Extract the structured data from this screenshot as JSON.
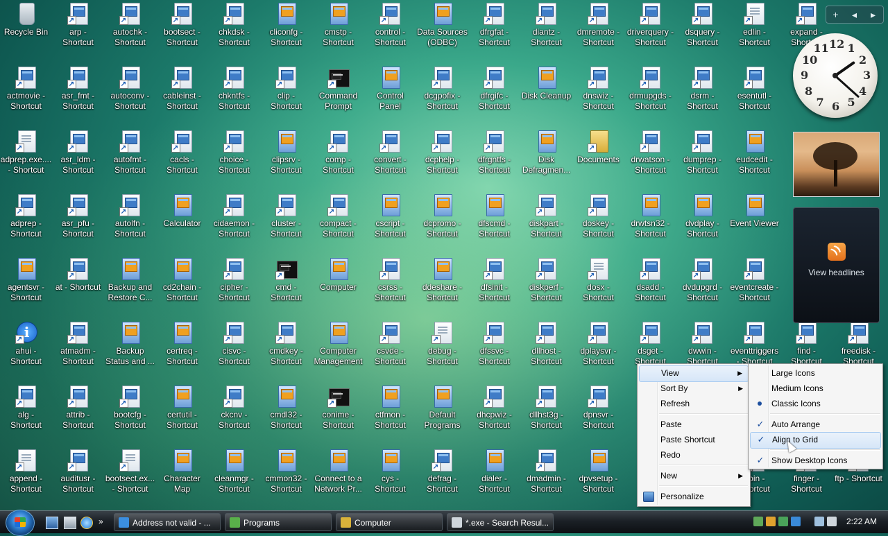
{
  "desktop": {
    "columns": [
      [
        {
          "label": "Recycle Bin",
          "icon": "recycle-bin-icon",
          "kind": "bin"
        },
        {
          "label": "actmovie -\nShortcut",
          "icon": "shortcut-icon",
          "kind": "sc"
        },
        {
          "label": "adprep.exe....\n- Shortcut",
          "icon": "shortcut-icon",
          "kind": "doc"
        },
        {
          "label": "adprep -\nShortcut",
          "icon": "shortcut-icon",
          "kind": "sc"
        },
        {
          "label": "agentsvr -\nShortcut",
          "icon": "shortcut-icon",
          "kind": "app"
        },
        {
          "label": "ahui -\nShortcut",
          "icon": "info-icon",
          "kind": "info"
        },
        {
          "label": "alg -\nShortcut",
          "icon": "shortcut-icon",
          "kind": "sc"
        },
        {
          "label": "append -\nShortcut",
          "icon": "shortcut-icon",
          "kind": "doc"
        }
      ],
      [
        {
          "label": "arp -\nShortcut",
          "icon": "shortcut-icon",
          "kind": "sc"
        },
        {
          "label": "asr_fmt -\nShortcut",
          "icon": "shortcut-icon",
          "kind": "sc"
        },
        {
          "label": "asr_ldm -\nShortcut",
          "icon": "shortcut-icon",
          "kind": "sc"
        },
        {
          "label": "asr_pfu -\nShortcut",
          "icon": "shortcut-icon",
          "kind": "sc"
        },
        {
          "label": "at - Shortcut",
          "icon": "shortcut-icon",
          "kind": "sc"
        },
        {
          "label": "atmadm -\nShortcut",
          "icon": "shortcut-icon",
          "kind": "sc"
        },
        {
          "label": "attrib -\nShortcut",
          "icon": "shortcut-icon",
          "kind": "sc"
        },
        {
          "label": "auditusr -\nShortcut",
          "icon": "shortcut-icon",
          "kind": "sc"
        }
      ],
      [
        {
          "label": "autochk -\nShortcut",
          "icon": "shortcut-icon",
          "kind": "sc"
        },
        {
          "label": "autoconv -\nShortcut",
          "icon": "shortcut-icon",
          "kind": "sc"
        },
        {
          "label": "autofmt -\nShortcut",
          "icon": "shortcut-icon",
          "kind": "sc"
        },
        {
          "label": "autolfn -\nShortcut",
          "icon": "shortcut-icon",
          "kind": "sc"
        },
        {
          "label": "Backup and\nRestore C...",
          "icon": "backup-icon",
          "kind": "app"
        },
        {
          "label": "Backup\nStatus and ...",
          "icon": "backup-icon",
          "kind": "app"
        },
        {
          "label": "bootcfg -\nShortcut",
          "icon": "shortcut-icon",
          "kind": "sc"
        },
        {
          "label": "bootsect.ex...\n- Shortcut",
          "icon": "shortcut-icon",
          "kind": "doc"
        }
      ],
      [
        {
          "label": "bootsect -\nShortcut",
          "icon": "shortcut-icon",
          "kind": "sc"
        },
        {
          "label": "cableinst -\nShortcut",
          "icon": "shortcut-icon",
          "kind": "sc"
        },
        {
          "label": "cacls -\nShortcut",
          "icon": "shortcut-icon",
          "kind": "sc"
        },
        {
          "label": "Calculator",
          "icon": "calculator-icon",
          "kind": "app"
        },
        {
          "label": "cd2chain -\nShortcut",
          "icon": "shortcut-icon",
          "kind": "app"
        },
        {
          "label": "certreq -\nShortcut",
          "icon": "shortcut-icon",
          "kind": "app"
        },
        {
          "label": "certutil -\nShortcut",
          "icon": "shortcut-icon",
          "kind": "app"
        },
        {
          "label": "Character\nMap",
          "icon": "character-map-icon",
          "kind": "app"
        }
      ],
      [
        {
          "label": "chkdsk -\nShortcut",
          "icon": "shortcut-icon",
          "kind": "sc"
        },
        {
          "label": "chkntfs -\nShortcut",
          "icon": "shortcut-icon",
          "kind": "sc"
        },
        {
          "label": "choice -\nShortcut",
          "icon": "shortcut-icon",
          "kind": "sc"
        },
        {
          "label": "cidaemon -\nShortcut",
          "icon": "shortcut-icon",
          "kind": "sc"
        },
        {
          "label": "cipher -\nShortcut",
          "icon": "shortcut-icon",
          "kind": "sc"
        },
        {
          "label": "cisvc -\nShortcut",
          "icon": "shortcut-icon",
          "kind": "sc"
        },
        {
          "label": "ckcnv -\nShortcut",
          "icon": "shortcut-icon",
          "kind": "sc"
        },
        {
          "label": "cleanmgr -\nShortcut",
          "icon": "shortcut-icon",
          "kind": "app"
        }
      ],
      [
        {
          "label": "cliconfg -\nShortcut",
          "icon": "shortcut-icon",
          "kind": "app"
        },
        {
          "label": "clip -\nShortcut",
          "icon": "shortcut-icon",
          "kind": "sc"
        },
        {
          "label": "clipsrv -\nShortcut",
          "icon": "shortcut-icon",
          "kind": "app"
        },
        {
          "label": "cluster -\nShortcut",
          "icon": "shortcut-icon",
          "kind": "sc"
        },
        {
          "label": "cmd -\nShortcut",
          "icon": "cmd-icon",
          "kind": "cmd"
        },
        {
          "label": "cmdkey -\nShortcut",
          "icon": "shortcut-icon",
          "kind": "sc"
        },
        {
          "label": "cmdl32 -\nShortcut",
          "icon": "shortcut-icon",
          "kind": "app"
        },
        {
          "label": "cmmon32 -\nShortcut",
          "icon": "shortcut-icon",
          "kind": "app"
        }
      ],
      [
        {
          "label": "cmstp -\nShortcut",
          "icon": "shortcut-icon",
          "kind": "app"
        },
        {
          "label": "Command\nPrompt",
          "icon": "cmd-icon",
          "kind": "cmd"
        },
        {
          "label": "comp -\nShortcut",
          "icon": "shortcut-icon",
          "kind": "sc"
        },
        {
          "label": "compact -\nShortcut",
          "icon": "shortcut-icon",
          "kind": "sc"
        },
        {
          "label": "Computer",
          "icon": "computer-icon",
          "kind": "app"
        },
        {
          "label": "Computer\nManagement",
          "icon": "computer-icon",
          "kind": "app"
        },
        {
          "label": "conime -\nShortcut",
          "icon": "cmd-icon",
          "kind": "cmd"
        },
        {
          "label": "Connect to a\nNetwork Pr...",
          "icon": "network-icon",
          "kind": "app"
        }
      ],
      [
        {
          "label": "control -\nShortcut",
          "icon": "shortcut-icon",
          "kind": "sc"
        },
        {
          "label": "Control\nPanel",
          "icon": "control-panel-icon",
          "kind": "app"
        },
        {
          "label": "convert -\nShortcut",
          "icon": "shortcut-icon",
          "kind": "sc"
        },
        {
          "label": "cscript -\nShortcut",
          "icon": "shortcut-icon",
          "kind": "app"
        },
        {
          "label": "csrss -\nShortcut",
          "icon": "shortcut-icon",
          "kind": "sc"
        },
        {
          "label": "csvde -\nShortcut",
          "icon": "shortcut-icon",
          "kind": "sc"
        },
        {
          "label": "ctfmon -\nShortcut",
          "icon": "shortcut-icon",
          "kind": "app"
        },
        {
          "label": "cys -\nShortcut",
          "icon": "shortcut-icon",
          "kind": "app"
        }
      ],
      [
        {
          "label": "Data Sources\n(ODBC)",
          "icon": "odbc-icon",
          "kind": "app"
        },
        {
          "label": "dcgpofix -\nShortcut",
          "icon": "shortcut-icon",
          "kind": "sc"
        },
        {
          "label": "dcphelp -\nShortcut",
          "icon": "shortcut-icon",
          "kind": "sc"
        },
        {
          "label": "dcpromo -\nShortcut",
          "icon": "shortcut-icon",
          "kind": "app"
        },
        {
          "label": "ddeshare -\nShortcut",
          "icon": "shortcut-icon",
          "kind": "app"
        },
        {
          "label": "debug -\nShortcut",
          "icon": "shortcut-icon",
          "kind": "doc"
        },
        {
          "label": "Default\nPrograms",
          "icon": "default-programs-icon",
          "kind": "app"
        },
        {
          "label": "defrag -\nShortcut",
          "icon": "shortcut-icon",
          "kind": "sc"
        }
      ],
      [
        {
          "label": "dfrgfat -\nShortcut",
          "icon": "shortcut-icon",
          "kind": "sc"
        },
        {
          "label": "dfrgifc -\nShortcut",
          "icon": "shortcut-icon",
          "kind": "sc"
        },
        {
          "label": "dfrgntfs -\nShortcut",
          "icon": "shortcut-icon",
          "kind": "sc"
        },
        {
          "label": "dfscmd -\nShortcut",
          "icon": "shortcut-icon",
          "kind": "app"
        },
        {
          "label": "dfsinit -\nShortcut",
          "icon": "shortcut-icon",
          "kind": "sc"
        },
        {
          "label": "dfssvc -\nShortcut",
          "icon": "shortcut-icon",
          "kind": "sc"
        },
        {
          "label": "dhcpwiz -\nShortcut",
          "icon": "shortcut-icon",
          "kind": "sc"
        },
        {
          "label": "dialer -\nShortcut",
          "icon": "shortcut-icon",
          "kind": "app"
        }
      ],
      [
        {
          "label": "diantz -\nShortcut",
          "icon": "shortcut-icon",
          "kind": "sc"
        },
        {
          "label": "Disk Cleanup",
          "icon": "disk-cleanup-icon",
          "kind": "app"
        },
        {
          "label": "Disk\nDefragmen...",
          "icon": "defrag-icon",
          "kind": "app"
        },
        {
          "label": "diskpart -\nShortcut",
          "icon": "shortcut-icon",
          "kind": "sc"
        },
        {
          "label": "diskperf -\nShortcut",
          "icon": "shortcut-icon",
          "kind": "sc"
        },
        {
          "label": "dllhost -\nShortcut",
          "icon": "shortcut-icon",
          "kind": "sc"
        },
        {
          "label": "dllhst3g -\nShortcut",
          "icon": "shortcut-icon",
          "kind": "sc"
        },
        {
          "label": "dmadmin -\nShortcut",
          "icon": "shortcut-icon",
          "kind": "sc"
        }
      ],
      [
        {
          "label": "dmremote -\nShortcut",
          "icon": "shortcut-icon",
          "kind": "sc"
        },
        {
          "label": "dnswiz -\nShortcut",
          "icon": "shortcut-icon",
          "kind": "sc"
        },
        {
          "label": "Documents",
          "icon": "documents-icon",
          "kind": "folder"
        },
        {
          "label": "doskey -\nShortcut",
          "icon": "shortcut-icon",
          "kind": "sc"
        },
        {
          "label": "dosx -\nShortcut",
          "icon": "shortcut-icon",
          "kind": "doc"
        },
        {
          "label": "dplaysvr -\nShortcut",
          "icon": "shortcut-icon",
          "kind": "sc"
        },
        {
          "label": "dpnsvr -\nShortcut",
          "icon": "shortcut-icon",
          "kind": "sc"
        },
        {
          "label": "dpvsetup -\nShortcut",
          "icon": "shortcut-icon",
          "kind": "app"
        }
      ],
      [
        {
          "label": "driverquery -\nShortcut",
          "icon": "shortcut-icon",
          "kind": "sc"
        },
        {
          "label": "drmupgds -\nShortcut",
          "icon": "shortcut-icon",
          "kind": "sc"
        },
        {
          "label": "drwatson -\nShortcut",
          "icon": "shortcut-icon",
          "kind": "sc"
        },
        {
          "label": "drwtsn32 -\nShortcut",
          "icon": "shortcut-icon",
          "kind": "app"
        },
        {
          "label": "dsadd -\nShortcut",
          "icon": "shortcut-icon",
          "kind": "sc"
        },
        {
          "label": "dsget -\nShortcut",
          "icon": "shortcut-icon",
          "kind": "sc"
        }
      ],
      [
        {
          "label": "dsquery -\nShortcut",
          "icon": "shortcut-icon",
          "kind": "sc"
        },
        {
          "label": "dsrm -\nShortcut",
          "icon": "shortcut-icon",
          "kind": "sc"
        },
        {
          "label": "dumprep -\nShortcut",
          "icon": "shortcut-icon",
          "kind": "sc"
        },
        {
          "label": "dvdplay -\nShortcut",
          "icon": "dvd-icon",
          "kind": "app"
        },
        {
          "label": "dvdupgrd -\nShortcut",
          "icon": "shortcut-icon",
          "kind": "sc"
        },
        {
          "label": "dwwin -\nShortcut",
          "icon": "shortcut-icon",
          "kind": "sc"
        }
      ],
      [
        {
          "label": "edlin -\nShortcut",
          "icon": "shortcut-icon",
          "kind": "doc"
        },
        {
          "label": "esentutl -\nShortcut",
          "icon": "shortcut-icon",
          "kind": "sc"
        },
        {
          "label": "eudcedit -\nShortcut",
          "icon": "shortcut-icon",
          "kind": "app"
        },
        {
          "label": "Event Viewer",
          "icon": "event-viewer-icon",
          "kind": "app"
        },
        {
          "label": "eventcreate -\nShortcut",
          "icon": "shortcut-icon",
          "kind": "sc"
        },
        {
          "label": "eventtriggers\n- Shortcut",
          "icon": "shortcut-icon",
          "kind": "sc"
        }
      ]
    ],
    "extra_icons": [
      {
        "label": "expand -\nShortcut",
        "kind": "sc",
        "col": 15,
        "row": 0
      },
      {
        "label": "find -\nShortcut",
        "kind": "sc",
        "col": 15,
        "row": 5
      },
      {
        "label": "2bin -\nShortcut",
        "kind": "sc",
        "col": 14,
        "row": 7
      },
      {
        "label": "finger -\nShortcut",
        "kind": "sc",
        "col": 15,
        "row": 7
      },
      {
        "label": "ftp - Shortcut",
        "kind": "sc",
        "col": 16,
        "row": 7
      },
      {
        "label": "freedisk -\nShortcut",
        "kind": "sc",
        "col": 16,
        "row": 5
      }
    ]
  },
  "gadgets": {
    "toolbar": {
      "add_label": "+",
      "prev_label": "◂",
      "next_label": "▸"
    },
    "clock_numbers": [
      "12",
      "1",
      "2",
      "3",
      "4",
      "5",
      "6",
      "7",
      "8",
      "9",
      "10",
      "11"
    ],
    "feed_text": "View headlines"
  },
  "context_menu": {
    "items": [
      {
        "label": "View",
        "submenu": true,
        "highlighted": true
      },
      {
        "label": "Sort By",
        "submenu": true
      },
      {
        "label": "Refresh"
      },
      {
        "separator": true
      },
      {
        "label": "Paste"
      },
      {
        "label": "Paste Shortcut"
      },
      {
        "label": "Redo"
      },
      {
        "separator": true
      },
      {
        "label": "New",
        "submenu": true
      },
      {
        "separator": true
      },
      {
        "label": "Personalize",
        "icon": "personalize-icon"
      }
    ]
  },
  "view_submenu": {
    "items": [
      {
        "label": "Large Icons"
      },
      {
        "label": "Medium Icons"
      },
      {
        "label": "Classic Icons",
        "mark": "radio"
      },
      {
        "separator": true
      },
      {
        "label": "Auto Arrange",
        "mark": "check"
      },
      {
        "label": "Align to Grid",
        "mark": "check",
        "highlighted": true
      },
      {
        "separator": true
      },
      {
        "label": "Show Desktop Icons",
        "mark": "check"
      }
    ]
  },
  "taskbar": {
    "buttons": [
      {
        "label": "Address not valid - ...",
        "icon": "internet-explorer-icon",
        "color": "#3b8fe0"
      },
      {
        "label": "Programs",
        "icon": "folder-icon",
        "color": "#59b04a"
      },
      {
        "label": "Computer",
        "icon": "folder-icon",
        "color": "#d9b23a"
      },
      {
        "label": "*.exe - Search Resul...",
        "icon": "search-folder-icon",
        "color": "#cfd6dc"
      }
    ],
    "clock": "2:22 AM"
  },
  "colors": {
    "accent": "#1d4f9f",
    "menu_bg": "#f5f5f5"
  }
}
